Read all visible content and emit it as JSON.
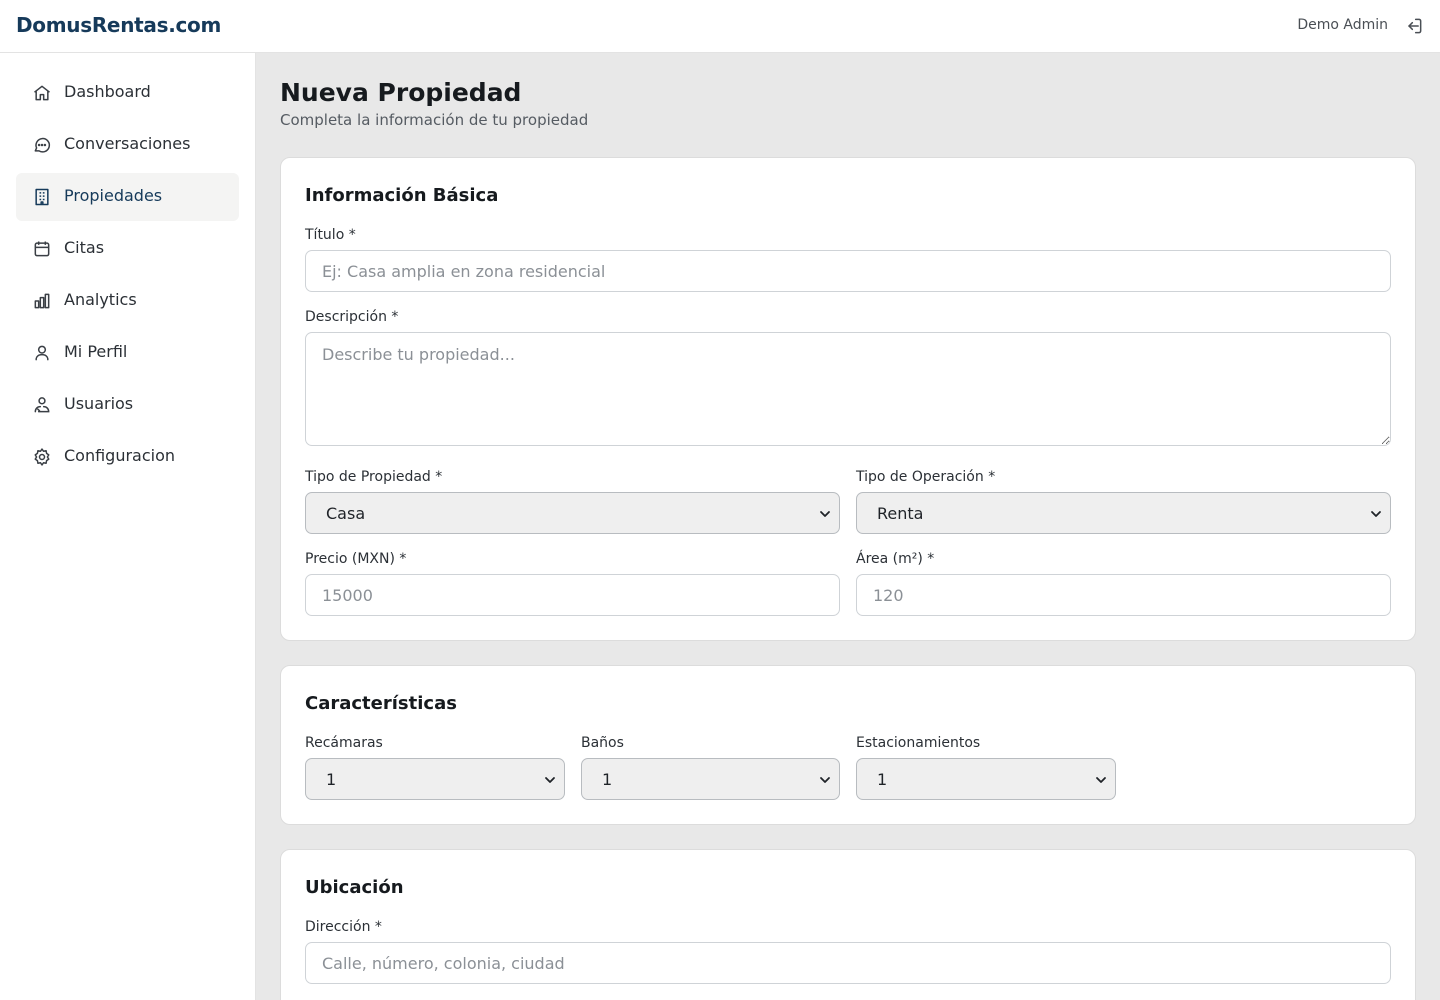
{
  "header": {
    "logo": "DomusRentas.com",
    "user_name": "Demo Admin"
  },
  "icons": {
    "logout": "logout-icon"
  },
  "sidebar": {
    "items": [
      {
        "label": "Dashboard",
        "icon": "home-icon",
        "active": false
      },
      {
        "label": "Conversaciones",
        "icon": "chat-icon",
        "active": false
      },
      {
        "label": "Propiedades",
        "icon": "building-icon",
        "active": true
      },
      {
        "label": "Citas",
        "icon": "calendar-icon",
        "active": false
      },
      {
        "label": "Analytics",
        "icon": "bar-chart-icon",
        "active": false
      },
      {
        "label": "Mi Perfil",
        "icon": "user-icon",
        "active": false
      },
      {
        "label": "Usuarios",
        "icon": "users-icon",
        "active": false
      },
      {
        "label": "Configuracion",
        "icon": "gear-icon",
        "active": false
      }
    ]
  },
  "page": {
    "title": "Nueva Propiedad",
    "subtitle": "Completa la información de tu propiedad"
  },
  "basic": {
    "title": "Información Básica",
    "titulo_label": "Título *",
    "titulo_placeholder": "Ej: Casa amplia en zona residencial",
    "descripcion_label": "Descripción *",
    "descripcion_placeholder": "Describe tu propiedad...",
    "tipo_propiedad_label": "Tipo de Propiedad *",
    "tipo_propiedad_value": "Casa",
    "tipo_operacion_label": "Tipo de Operación *",
    "tipo_operacion_value": "Renta",
    "precio_label": "Precio (MXN) *",
    "precio_placeholder": "15000",
    "area_label": "Área (m²) *",
    "area_placeholder": "120"
  },
  "features": {
    "title": "Características",
    "recamaras_label": "Recámaras",
    "recamaras_value": "1",
    "banos_label": "Baños",
    "banos_value": "1",
    "estacionamientos_label": "Estacionamientos",
    "estacionamientos_value": "1"
  },
  "location": {
    "title": "Ubicación",
    "direccion_label": "Dirección *",
    "direccion_placeholder": "Calle, número, colonia, ciudad"
  },
  "colors": {
    "brand": "#163a5a",
    "background": "#e8e8e8",
    "active_nav": "#f4f4f3"
  }
}
